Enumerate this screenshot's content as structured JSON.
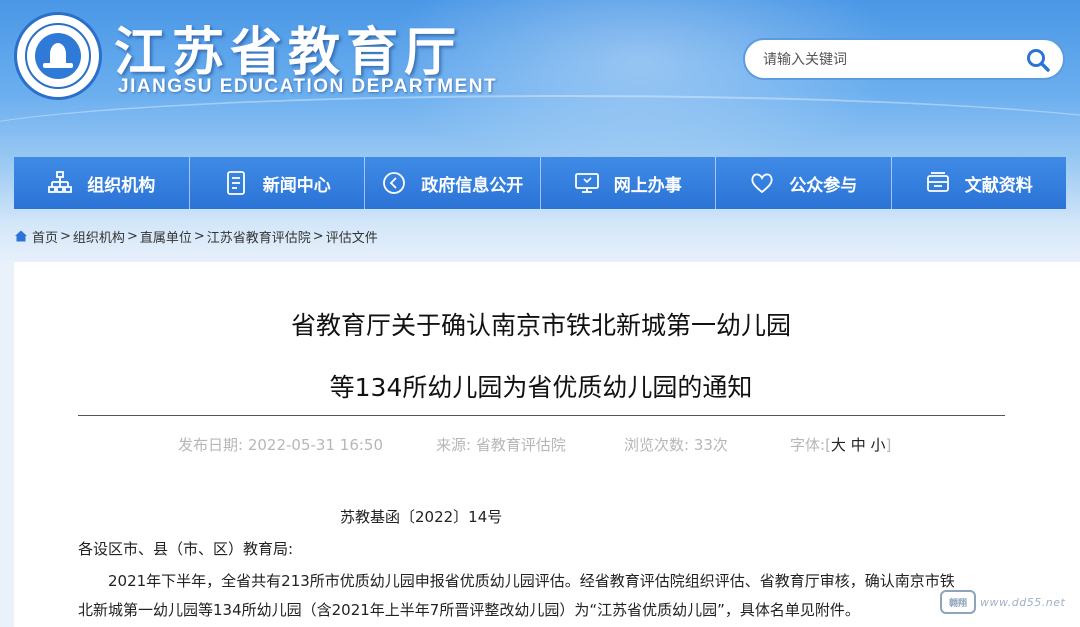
{
  "header": {
    "title": "江苏省教育厅",
    "subtitle": "JIANGSU EDUCATION DEPARTMENT"
  },
  "search": {
    "placeholder": "请输入关键词"
  },
  "nav": {
    "items": [
      {
        "label": "组织机构",
        "icon": "org-chart-icon"
      },
      {
        "label": "新闻中心",
        "icon": "news-document-icon"
      },
      {
        "label": "政府信息公开",
        "icon": "info-disclosure-icon"
      },
      {
        "label": "网上办事",
        "icon": "monitor-icon"
      },
      {
        "label": "公众参与",
        "icon": "heart-icon"
      },
      {
        "label": "文献资料",
        "icon": "archive-icon"
      }
    ]
  },
  "breadcrumb": {
    "items": [
      "首页",
      "组织机构",
      "直属单位",
      "江苏省教育评估院",
      "评估文件"
    ]
  },
  "article": {
    "title_line1": "省教育厅关于确认南京市铁北新城第一幼儿园",
    "title_line2": "等134所幼儿园为省优质幼儿园的通知",
    "meta": {
      "date_label": "发布日期:",
      "date": "2022-05-31 16:50",
      "source_label": "来源:",
      "source": "省教育评估院",
      "views_label": "浏览次数:",
      "views": "33次",
      "font_label": "字体:",
      "font_large": "大",
      "font_medium": "中",
      "font_small": "小"
    },
    "doc_number": "苏教基函〔2022〕14号",
    "salutation": "各设区市、县（市、区）教育局:",
    "paragraph_line1": "2021年下半年，全省共有213所市优质幼儿园申报省优质幼儿园评估。经省教育评估院组织评估、省教育厅审核，确认南京市铁",
    "paragraph_line2": "北新城第一幼儿园等134所幼儿园（含2021年上半年7所晋评整改幼儿园）为“江苏省优质幼儿园”，具体名单见附件。"
  },
  "watermark": {
    "badge": "翱翔",
    "text": "www.dd55.net"
  },
  "colors": {
    "nav_bg": "#2b73d6",
    "header_top": "#4a97e6",
    "meta_text": "#b7b7b7"
  }
}
